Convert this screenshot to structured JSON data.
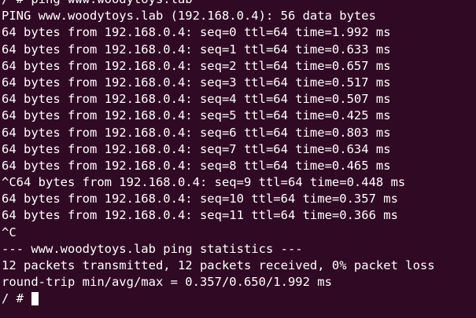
{
  "terminal": {
    "lines": [
      "/ # ping www.woodytoys.lab",
      "PING www.woodytoys.lab (192.168.0.4): 56 data bytes",
      "64 bytes from 192.168.0.4: seq=0 ttl=64 time=1.992 ms",
      "64 bytes from 192.168.0.4: seq=1 ttl=64 time=0.633 ms",
      "64 bytes from 192.168.0.4: seq=2 ttl=64 time=0.657 ms",
      "64 bytes from 192.168.0.4: seq=3 ttl=64 time=0.517 ms",
      "64 bytes from 192.168.0.4: seq=4 ttl=64 time=0.507 ms",
      "64 bytes from 192.168.0.4: seq=5 ttl=64 time=0.425 ms",
      "64 bytes from 192.168.0.4: seq=6 ttl=64 time=0.803 ms",
      "64 bytes from 192.168.0.4: seq=7 ttl=64 time=0.634 ms",
      "64 bytes from 192.168.0.4: seq=8 ttl=64 time=0.465 ms",
      "^C64 bytes from 192.168.0.4: seq=9 ttl=64 time=0.448 ms",
      "64 bytes from 192.168.0.4: seq=10 ttl=64 time=0.357 ms",
      "64 bytes from 192.168.0.4: seq=11 ttl=64 time=0.366 ms",
      "^C",
      "--- www.woodytoys.lab ping statistics ---",
      "12 packets transmitted, 12 packets received, 0% packet loss",
      "round-trip min/avg/max = 0.357/0.650/1.992 ms"
    ],
    "prompt": "/ # "
  },
  "colors": {
    "background": "#300a24",
    "text": "#ffffff"
  }
}
